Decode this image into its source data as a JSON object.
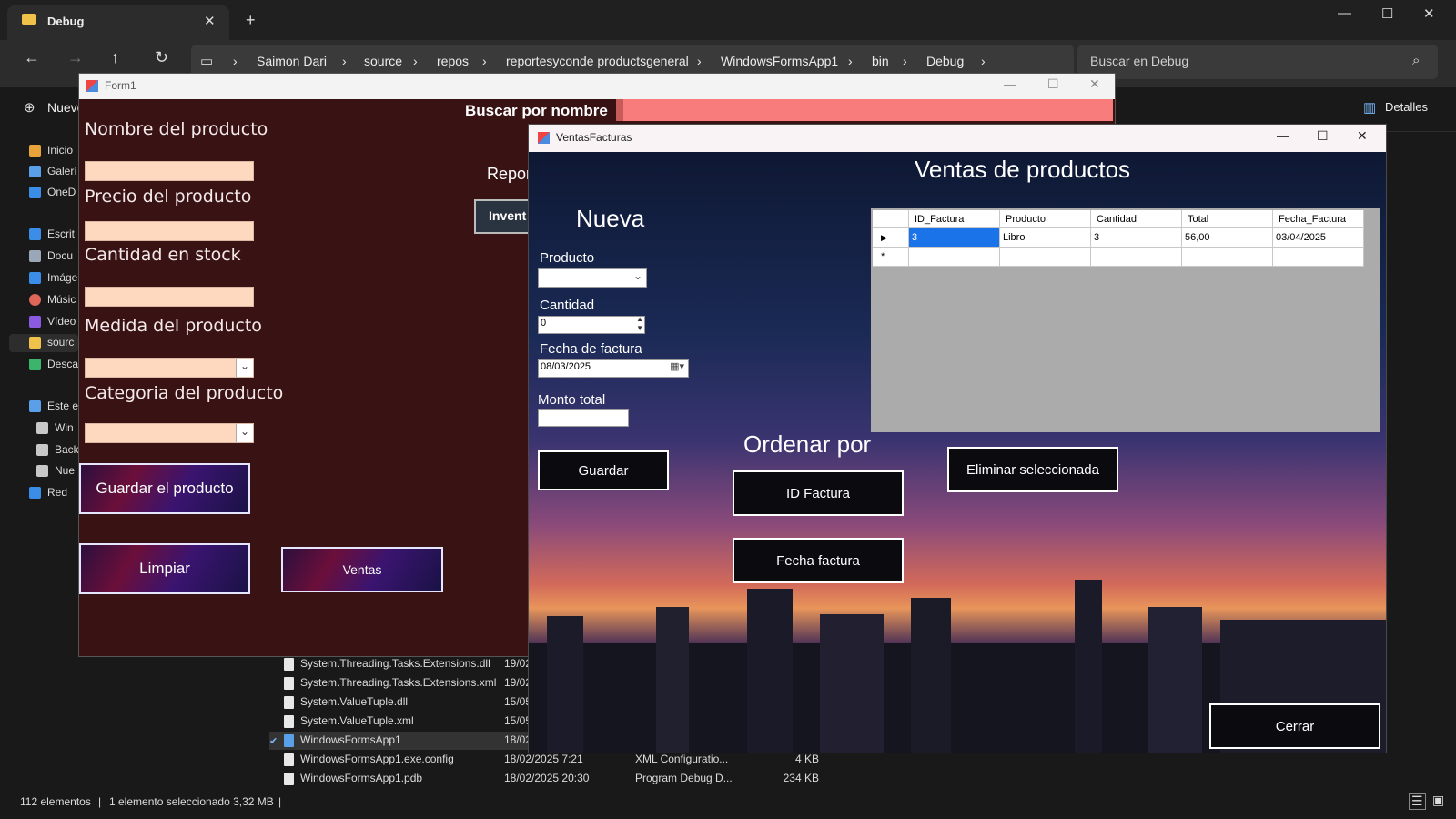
{
  "explorer": {
    "tab_title": "Debug",
    "breadcrumb": [
      "Saimon Dari",
      "source",
      "repos",
      "reportesyconde productsgeneral",
      "WindowsFormsApp1",
      "bin",
      "Debug"
    ],
    "search_placeholder": "Buscar en Debug",
    "new_label": "Nuevo",
    "details_label": "Detalles",
    "nav_items": [
      {
        "label": "Inicio",
        "icon": "home-icon"
      },
      {
        "label": "Galerí",
        "icon": "gallery-icon"
      },
      {
        "label": "OneD",
        "icon": "cloud-icon"
      },
      {
        "label": "Escrit",
        "icon": "desktop-icon"
      },
      {
        "label": "Docu",
        "icon": "document-icon"
      },
      {
        "label": "Imáge",
        "icon": "image-icon"
      },
      {
        "label": "Músic",
        "icon": "music-icon"
      },
      {
        "label": "Vídeo",
        "icon": "video-icon"
      },
      {
        "label": "sourc",
        "icon": "folder-icon"
      },
      {
        "label": "Desca",
        "icon": "download-icon"
      },
      {
        "label": "Este e",
        "icon": "pc-icon"
      },
      {
        "label": "Win",
        "icon": "drive-icon"
      },
      {
        "label": "Back",
        "icon": "drive-icon"
      },
      {
        "label": "Nue",
        "icon": "drive-icon"
      },
      {
        "label": "Red",
        "icon": "network-icon"
      }
    ],
    "files": [
      {
        "name": "System.Threading.Tasks.Extensions.dll",
        "date": "19/02",
        "type": "",
        "size": ""
      },
      {
        "name": "System.Threading.Tasks.Extensions.xml",
        "date": "19/02",
        "type": "",
        "size": ""
      },
      {
        "name": "System.ValueTuple.dll",
        "date": "15/05",
        "type": "",
        "size": ""
      },
      {
        "name": "System.ValueTuple.xml",
        "date": "15/05",
        "type": "",
        "size": ""
      },
      {
        "name": "WindowsFormsApp1",
        "date": "18/02",
        "type": "",
        "size": ""
      },
      {
        "name": "WindowsFormsApp1.exe.config",
        "date": "18/02/2025 7:21",
        "type": "XML Configuratio...",
        "size": "4 KB"
      },
      {
        "name": "WindowsFormsApp1.pdb",
        "date": "18/02/2025 20:30",
        "type": "Program Debug D...",
        "size": "234 KB"
      }
    ],
    "status": {
      "count": "112 elementos",
      "selection": "1 elemento seleccionado  3,32 MB"
    }
  },
  "form1": {
    "title": "Form1",
    "search_label": "Buscar por nombre",
    "labels": {
      "nombre": "Nombre del producto",
      "precio": "Precio del producto",
      "cantidad": "Cantidad en stock",
      "medida": "Medida del producto",
      "categoria": "Categoria del producto"
    },
    "report_label": "Repor",
    "inventory_button": "Invent",
    "buttons": {
      "guardar": "Guardar el producto",
      "limpiar": "Limpiar",
      "ventas": "Ventas"
    }
  },
  "ventas": {
    "title": "VentasFacturas",
    "heading": "Ventas de productos",
    "nueva": "Nueva",
    "producto_label": "Producto",
    "producto_value": "",
    "cantidad_label": "Cantidad",
    "cantidad_value": "0",
    "fecha_label": "Fecha de factura",
    "fecha_value": "08/03/2025",
    "monto_label": "Monto total",
    "monto_value": "",
    "guardar": "Guardar",
    "ordenar": "Ordenar por",
    "btn_id": "ID Factura",
    "btn_fecha": "Fecha factura",
    "btn_eliminar": "Eliminar seleccionada",
    "btn_cerrar": "Cerrar",
    "grid": {
      "columns": [
        "ID_Factura",
        "Producto",
        "Cantidad",
        "Total",
        "Fecha_Factura"
      ],
      "rows": [
        [
          "3",
          "Libro",
          "3",
          "56,00",
          "03/04/2025"
        ]
      ],
      "new_row_marker": "*"
    }
  }
}
